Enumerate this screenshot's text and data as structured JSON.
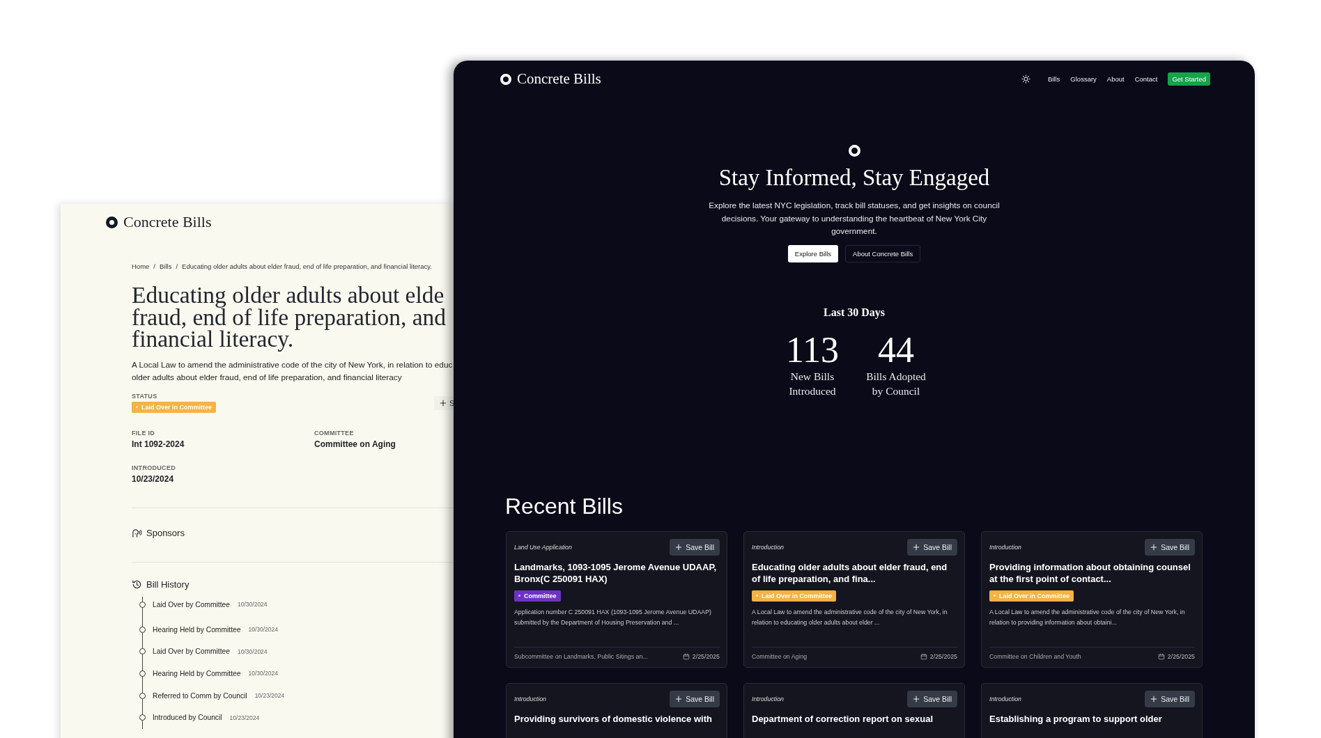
{
  "detail_page": {
    "logo": "Concrete Bills",
    "breadcrumb": [
      "Home",
      "Bills",
      "Educating older adults about elder fraud, end of life preparation, and financial literacy."
    ],
    "breadcrumb_separator": "/",
    "title_lines": [
      "Educating older adults about elde",
      "fraud, end of life preparation, and",
      "financial literacy."
    ],
    "description_lines": [
      "A Local Law to amend the administrative code of the city of New York, in relation to educ",
      "older adults about elder fraud, end of life preparation, and financial literacy"
    ],
    "status_label": "STATUS",
    "status": {
      "label": "Laid Over in Committee",
      "color": "#f5b342"
    },
    "save_button": "S",
    "fields": [
      {
        "label": "FILE ID",
        "value": "Int 1092-2024"
      },
      {
        "label": "COMMITTEE",
        "value": "Committee on Aging"
      },
      {
        "label": "INTRODUCED",
        "value": "10/23/2024"
      }
    ],
    "sponsors_heading": "Sponsors",
    "history_heading": "Bill History",
    "history": [
      {
        "action": "Laid Over by Committee",
        "date": "10/30/2024"
      },
      {
        "action": "Hearing Held by Committee",
        "date": "10/30/2024"
      },
      {
        "action": "Laid Over by Committee",
        "date": "10/30/2024"
      },
      {
        "action": "Hearing Held by Committee",
        "date": "10/30/2024"
      },
      {
        "action": "Referred to Comm by Council",
        "date": "10/23/2024"
      },
      {
        "action": "Introduced by Council",
        "date": "10/23/2024"
      }
    ]
  },
  "home_page": {
    "logo": "Concrete Bills",
    "nav": [
      "Bills",
      "Glossary",
      "About",
      "Contact"
    ],
    "cta": "Get Started",
    "hero": {
      "title": "Stay Informed, Stay Engaged",
      "text": "Explore the latest NYC legislation, track bill statuses, and get insights on council decisions. Your gateway to understanding the heartbeat of New York City government.",
      "buttons": [
        "Explore Bills",
        "About Concrete Bills"
      ]
    },
    "stats_title": "Last 30 Days",
    "stats": [
      {
        "value": "113",
        "label": "New Bills Introduced"
      },
      {
        "value": "44",
        "label": "Bills Adopted by Council"
      }
    ],
    "recent_heading": "Recent Bills",
    "bills": [
      {
        "type": "Land Use Application",
        "save": "Save Bill",
        "title": "Landmarks, 1093-1095 Jerome Avenue UDAAP, Bronx(C 250091 HAX)",
        "status": {
          "label": "Committee",
          "color": "#6d32c4"
        },
        "summary": "Application number C 250091 HAX (1093-1095 Jerome Avenue UDAAP) submitted by the Department of Housing Preservation and ...",
        "committee": "Subcommittee on Landmarks, Public Sitings an...",
        "date": "2/25/2025"
      },
      {
        "type": "Introduction",
        "save": "Save Bill",
        "title": "Educating older adults about elder fraud, end of life preparation, and fina...",
        "status": {
          "label": "Laid Over in Committee",
          "color": "#f5b342"
        },
        "summary": "A Local Law to amend the administrative code of the city of New York, in relation to educating older adults about elder ...",
        "committee": "Committee on Aging",
        "date": "2/25/2025"
      },
      {
        "type": "Introduction",
        "save": "Save Bill",
        "title": "Providing information about obtaining counsel at the first point of contact...",
        "status": {
          "label": "Laid Over in Committee",
          "color": "#f5b342"
        },
        "summary": "A Local Law to amend the administrative code of the city of New York, in relation to providing information about obtaini...",
        "committee": "Committee on Children and Youth",
        "date": "2/25/2025"
      },
      {
        "type": "Introduction",
        "save": "Save Bill",
        "title": "Providing survivors of domestic violence with"
      },
      {
        "type": "Introduction",
        "save": "Save Bill",
        "title": "Department of correction report on sexual"
      },
      {
        "type": "Introduction",
        "save": "Save Bill",
        "title": "Establishing a program to support older"
      }
    ]
  }
}
